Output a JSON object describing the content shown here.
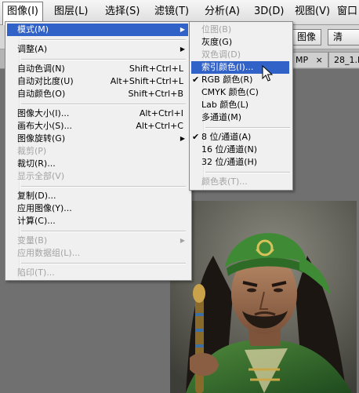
{
  "menubar": {
    "items": [
      "图像(I)",
      "图层(L)",
      "选择(S)",
      "滤镜(T)",
      "分析(A)",
      "3D(D)",
      "视图(V)",
      "窗口"
    ]
  },
  "optionsbar": {
    "button1": "图像",
    "button2": "清"
  },
  "tabs": {
    "tab1": "MP",
    "close": "×",
    "tab2": "28_1.E"
  },
  "menu_main": {
    "items": [
      {
        "label": "模式(M)",
        "shortcut": ""
      },
      {
        "label": "调整(A)",
        "shortcut": ""
      },
      {
        "label": "自动色调(N)",
        "shortcut": "Shift+Ctrl+L"
      },
      {
        "label": "自动对比度(U)",
        "shortcut": "Alt+Shift+Ctrl+L"
      },
      {
        "label": "自动颜色(O)",
        "shortcut": "Shift+Ctrl+B"
      },
      {
        "label": "图像大小(I)...",
        "shortcut": "Alt+Ctrl+I"
      },
      {
        "label": "画布大小(S)...",
        "shortcut": "Alt+Ctrl+C"
      },
      {
        "label": "图像旋转(G)",
        "shortcut": ""
      },
      {
        "label": "裁剪(P)",
        "shortcut": ""
      },
      {
        "label": "裁切(R)...",
        "shortcut": ""
      },
      {
        "label": "显示全部(V)",
        "shortcut": ""
      },
      {
        "label": "复制(D)...",
        "shortcut": ""
      },
      {
        "label": "应用图像(Y)...",
        "shortcut": ""
      },
      {
        "label": "计算(C)...",
        "shortcut": ""
      },
      {
        "label": "变量(B)",
        "shortcut": ""
      },
      {
        "label": "应用数据组(L)...",
        "shortcut": ""
      },
      {
        "label": "陷印(T)...",
        "shortcut": ""
      }
    ]
  },
  "menu_sub": {
    "items": [
      {
        "label": "位图(B)"
      },
      {
        "label": "灰度(G)"
      },
      {
        "label": "双色调(D)"
      },
      {
        "label": "索引颜色(I)..."
      },
      {
        "label": "RGB 颜色(R)"
      },
      {
        "label": "CMYK 颜色(C)"
      },
      {
        "label": "Lab 颜色(L)"
      },
      {
        "label": "多通道(M)"
      },
      {
        "label": "8 位/通道(A)"
      },
      {
        "label": "16 位/通道(N)"
      },
      {
        "label": "32 位/通道(H)"
      },
      {
        "label": "颜色表(T)..."
      }
    ]
  },
  "glyphs": {
    "arrow": "▶",
    "check": "✔"
  },
  "colors": {
    "highlight": "#3162c8",
    "menu_bg": "#f0f0f0",
    "disabled": "#a3a3a3"
  }
}
